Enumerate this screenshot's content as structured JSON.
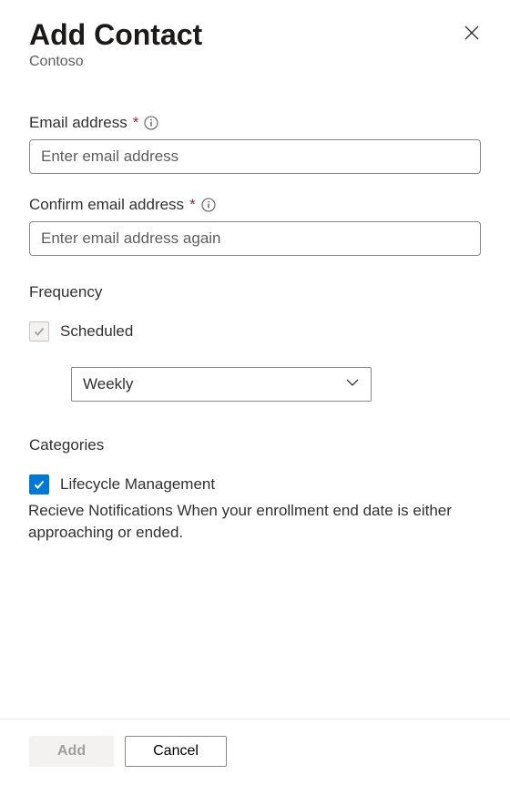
{
  "header": {
    "title": "Add Contact",
    "subtitle": "Contoso"
  },
  "fields": {
    "email": {
      "label": "Email address",
      "placeholder": "Enter email address",
      "value": ""
    },
    "confirm_email": {
      "label": "Confirm email address",
      "placeholder": "Enter email address again",
      "value": ""
    }
  },
  "frequency": {
    "label": "Frequency",
    "scheduled_label": "Scheduled",
    "select_value": "Weekly"
  },
  "categories": {
    "label": "Categories",
    "item_label": "Lifecycle Management",
    "item_desc": "Recieve Notifications When your enrollment end date is either approaching or ended."
  },
  "footer": {
    "add_label": "Add",
    "cancel_label": "Cancel"
  }
}
